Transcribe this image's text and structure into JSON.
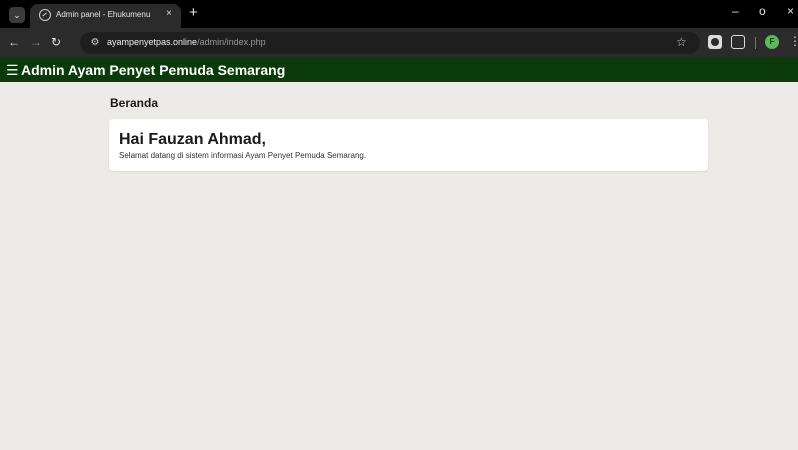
{
  "browser": {
    "tab_title": "Admin panel - Ehukumenu",
    "tab_close": "×",
    "new_tab": "+",
    "win_minimize": "–",
    "win_maximize": "o",
    "win_close": "×",
    "url_host": "ayampenyetpas.online",
    "url_path": "/admin/index.php",
    "avatar_initial": "F",
    "icons": {
      "tab_search": "chevron-down-icon",
      "favicon": "globe-icon",
      "back": "back-arrow-icon",
      "forward": "forward-arrow-icon",
      "reload": "reload-icon",
      "site_info": "tune-icon",
      "bookmark": "star-icon",
      "extension1": "extension-icon",
      "extension2": "puzzle-icon",
      "menu": "kebab-menu-icon"
    }
  },
  "app": {
    "title": "Admin Ayam Penyet Pemuda Semarang",
    "header_color": "#0a3a0a",
    "icons": {
      "menu": "hamburger-icon"
    }
  },
  "main": {
    "section_title": "Beranda",
    "greeting": "Hai Fauzan Ahmad,",
    "welcome": "Selamat datang di sistem informasi Ayam Penyet Pemuda Semarang."
  },
  "colors": {
    "page_bg": "#ecebe7",
    "card_bg": "#ffffff"
  }
}
